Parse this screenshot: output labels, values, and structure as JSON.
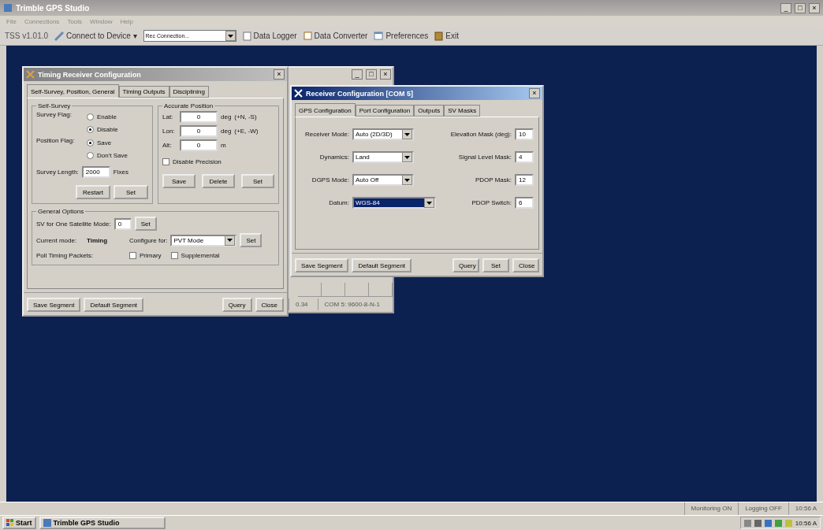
{
  "app": {
    "title": "Trimble GPS Studio",
    "title_buttons": [
      "_",
      "□",
      "×"
    ],
    "menu": [
      "File",
      "Connections",
      "Tools",
      "Window",
      "Help"
    ]
  },
  "toolbar": {
    "version": "TSS v1.01.0",
    "connect": "Connect to Device",
    "connect_caret": "▾",
    "connection": "Rec Connection...",
    "items": [
      {
        "label": "Data Logger",
        "kind": "logger"
      },
      {
        "label": "Data Converter",
        "kind": "converter"
      },
      {
        "label": "Preferences",
        "kind": "preferences"
      },
      {
        "label": "Exit",
        "kind": "exit"
      }
    ]
  },
  "timing_window": {
    "title": "Timing Receiver Configuration",
    "close": "×",
    "tabs": [
      {
        "label": "Self-Survey, Position, General",
        "selected": true
      },
      {
        "label": "Timing Outputs",
        "selected": false
      },
      {
        "label": "Disciplining",
        "selected": false
      }
    ],
    "self_survey": {
      "title": "Self-Survey",
      "survey_flag_label": "Survey Flag:",
      "survey_options": [
        {
          "label": "Enable",
          "selected": false
        },
        {
          "label": "Disable",
          "selected": true
        }
      ],
      "position_flag_label": "Position Flag:",
      "position_options": [
        {
          "label": "Save",
          "selected": true
        },
        {
          "label": "Don't Save",
          "selected": false
        }
      ],
      "survey_length_label": "Survey Length:",
      "survey_length": "2000",
      "survey_length_unit": "Fixes",
      "buttons": [
        "Restart",
        "Set"
      ]
    },
    "accurate_position": {
      "title": "Accurate Position",
      "fields": [
        {
          "label": "Lat:",
          "value": "0",
          "unit": "deg",
          "hint": "(+N, -S)"
        },
        {
          "label": "Lon:",
          "value": "0",
          "unit": "deg",
          "hint": "(+E, -W)"
        },
        {
          "label": "Alt:",
          "value": "0",
          "unit": "m"
        }
      ],
      "disable_precision": {
        "label": "Disable Precision",
        "checked": false
      },
      "buttons": [
        "Save",
        "Delete",
        "Set"
      ]
    },
    "general": {
      "title": "General Options",
      "sv_label": "SV for One Satellite Mode:",
      "sv_value": "0",
      "sv_button": "Set",
      "current_mode_label": "Current mode:",
      "current_mode": "Timing",
      "configure_label": "Configure for:",
      "configure_value": "PVT Mode",
      "configure_button": "Set",
      "poll_label": "Poll Timing Packets:",
      "poll_options": [
        {
          "label": "Primary",
          "checked": false
        },
        {
          "label": "Supplemental",
          "checked": false
        }
      ]
    },
    "footer_left": [
      "Save Segment",
      "Default Segment"
    ],
    "footer_right": [
      "Query",
      "Close"
    ]
  },
  "background_window": {
    "title_buttons": [
      "_",
      "□",
      "×"
    ],
    "status": [
      "0.34",
      "COM 5: 9600-8-N-1"
    ]
  },
  "receiver_window": {
    "title": "Receiver Configuration [COM 5]",
    "close": "×",
    "tabs": [
      {
        "label": "GPS Configuration",
        "selected": true
      },
      {
        "label": "Port Configuration",
        "selected": false
      },
      {
        "label": "Outputs",
        "selected": false
      },
      {
        "label": "SV Masks",
        "selected": false
      }
    ],
    "selects": [
      {
        "label": "Receiver Mode:",
        "value": "Auto (2D/3D)",
        "focused": false
      },
      {
        "label": "Dynamics:",
        "value": "Land",
        "focused": false
      },
      {
        "label": "DGPS Mode:",
        "value": "Auto Off",
        "focused": false
      },
      {
        "label": "Datum:",
        "value": "WGS-84",
        "focused": true
      }
    ],
    "masks": [
      {
        "label": "Elevation Mask (deg):",
        "value": "10"
      },
      {
        "label": "Signal Level Mask:",
        "value": "4"
      },
      {
        "label": "PDOP Mask:",
        "value": "12"
      },
      {
        "label": "PDOP Switch:",
        "value": "6"
      }
    ],
    "footer_left": [
      "Save Segment",
      "Default Segment"
    ],
    "footer_right": [
      "Query",
      "Set",
      "Close"
    ]
  },
  "status_bar": [
    "Monitoring ON",
    "Logging OFF",
    "10:56 A"
  ],
  "taskbar": {
    "start": "Start",
    "tasks": [
      {
        "label": "Trimble GPS Studio",
        "selected": false
      }
    ],
    "clock": "10:56 A"
  }
}
